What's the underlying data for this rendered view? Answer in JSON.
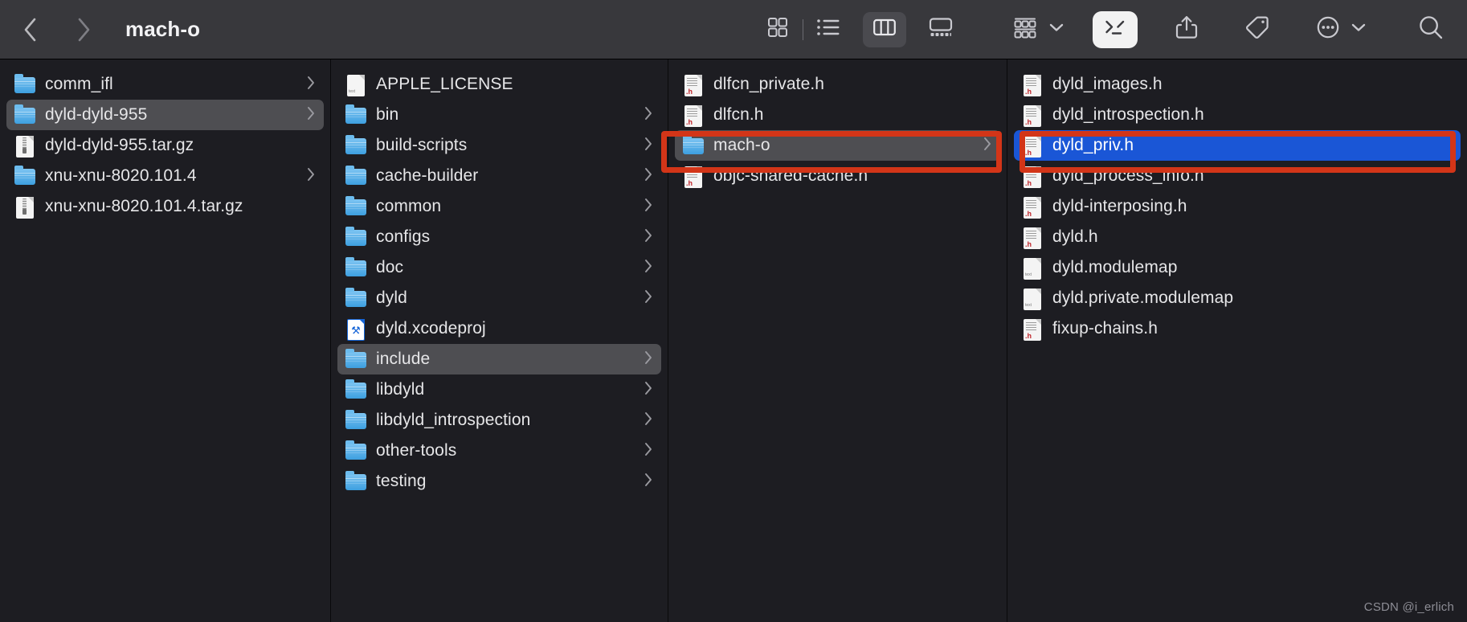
{
  "window": {
    "title": "mach-o",
    "watermark": "CSDN @i_erlich"
  },
  "toolbar": {
    "back_icon": "chevron-left-icon",
    "forward_icon": "chevron-right-icon",
    "view_icon_grid": "icon-view-icon",
    "view_icon_list": "list-view-icon",
    "view_icon_column": "column-view-icon",
    "view_icon_gallery": "gallery-view-icon",
    "group_icon": "group-by-icon",
    "group_caret": "chevron-down-icon",
    "terminal_icon": "terminal-icon",
    "share_icon": "share-icon",
    "tag_icon": "tag-icon",
    "more_icon": "more-ellipsis-icon",
    "more_caret": "chevron-down-icon",
    "search_icon": "search-icon",
    "active_view": "column",
    "colors": {
      "toolbar_bg": "#38383c",
      "active_segment_bg": "#4a4a4f",
      "terminal_button_bg": "#f2f2f2"
    }
  },
  "columns": [
    {
      "name": "column-1",
      "items": [
        {
          "label": "comm_ifl",
          "icon": "folder-icon",
          "arrow": true,
          "selected": "none"
        },
        {
          "label": "dyld-dyld-955",
          "icon": "folder-icon",
          "arrow": true,
          "selected": "gray"
        },
        {
          "label": "dyld-dyld-955.tar.gz",
          "icon": "archive-icon",
          "arrow": false,
          "selected": "none"
        },
        {
          "label": "xnu-xnu-8020.101.4",
          "icon": "folder-icon",
          "arrow": true,
          "selected": "none"
        },
        {
          "label": "xnu-xnu-8020.101.4.tar.gz",
          "icon": "archive-icon",
          "arrow": false,
          "selected": "none"
        }
      ]
    },
    {
      "name": "column-2",
      "items": [
        {
          "label": "APPLE_LICENSE",
          "icon": "document-icon",
          "arrow": false,
          "selected": "none"
        },
        {
          "label": "bin",
          "icon": "folder-icon",
          "arrow": true,
          "selected": "none"
        },
        {
          "label": "build-scripts",
          "icon": "folder-icon",
          "arrow": true,
          "selected": "none"
        },
        {
          "label": "cache-builder",
          "icon": "folder-icon",
          "arrow": true,
          "selected": "none"
        },
        {
          "label": "common",
          "icon": "folder-icon",
          "arrow": true,
          "selected": "none"
        },
        {
          "label": "configs",
          "icon": "folder-icon",
          "arrow": true,
          "selected": "none"
        },
        {
          "label": "doc",
          "icon": "folder-icon",
          "arrow": true,
          "selected": "none"
        },
        {
          "label": "dyld",
          "icon": "folder-icon",
          "arrow": true,
          "selected": "none"
        },
        {
          "label": "dyld.xcodeproj",
          "icon": "xcodeproj-icon",
          "arrow": false,
          "selected": "none"
        },
        {
          "label": "include",
          "icon": "folder-icon",
          "arrow": true,
          "selected": "gray"
        },
        {
          "label": "libdyld",
          "icon": "folder-icon",
          "arrow": true,
          "selected": "none"
        },
        {
          "label": "libdyld_introspection",
          "icon": "folder-icon",
          "arrow": true,
          "selected": "none"
        },
        {
          "label": "other-tools",
          "icon": "folder-icon",
          "arrow": true,
          "selected": "none"
        },
        {
          "label": "testing",
          "icon": "folder-icon",
          "arrow": true,
          "selected": "none"
        }
      ]
    },
    {
      "name": "column-3",
      "items": [
        {
          "label": "dlfcn_private.h",
          "icon": "header-file-icon",
          "arrow": false,
          "selected": "none"
        },
        {
          "label": "dlfcn.h",
          "icon": "header-file-icon",
          "arrow": false,
          "selected": "none"
        },
        {
          "label": "mach-o",
          "icon": "folder-icon",
          "arrow": true,
          "selected": "gray"
        },
        {
          "label": "objc-shared-cache.h",
          "icon": "header-file-icon",
          "arrow": false,
          "selected": "none"
        }
      ]
    },
    {
      "name": "column-4",
      "items": [
        {
          "label": "dyld_images.h",
          "icon": "header-file-icon",
          "arrow": false,
          "selected": "none"
        },
        {
          "label": "dyld_introspection.h",
          "icon": "header-file-icon",
          "arrow": false,
          "selected": "none"
        },
        {
          "label": "dyld_priv.h",
          "icon": "header-file-icon",
          "arrow": false,
          "selected": "blue"
        },
        {
          "label": "dyld_process_info.h",
          "icon": "header-file-icon",
          "arrow": false,
          "selected": "none"
        },
        {
          "label": "dyld-interposing.h",
          "icon": "header-file-icon",
          "arrow": false,
          "selected": "none"
        },
        {
          "label": "dyld.h",
          "icon": "header-file-icon",
          "arrow": false,
          "selected": "none"
        },
        {
          "label": "dyld.modulemap",
          "icon": "document-icon",
          "arrow": false,
          "selected": "none"
        },
        {
          "label": "dyld.private.modulemap",
          "icon": "document-icon",
          "arrow": false,
          "selected": "none"
        },
        {
          "label": "fixup-chains.h",
          "icon": "header-file-icon",
          "arrow": false,
          "selected": "none"
        }
      ]
    }
  ],
  "annotations": [
    {
      "name": "red-highlight-mach-o",
      "color": "#d33518"
    },
    {
      "name": "red-highlight-dyld-priv",
      "color": "#d33518"
    }
  ]
}
